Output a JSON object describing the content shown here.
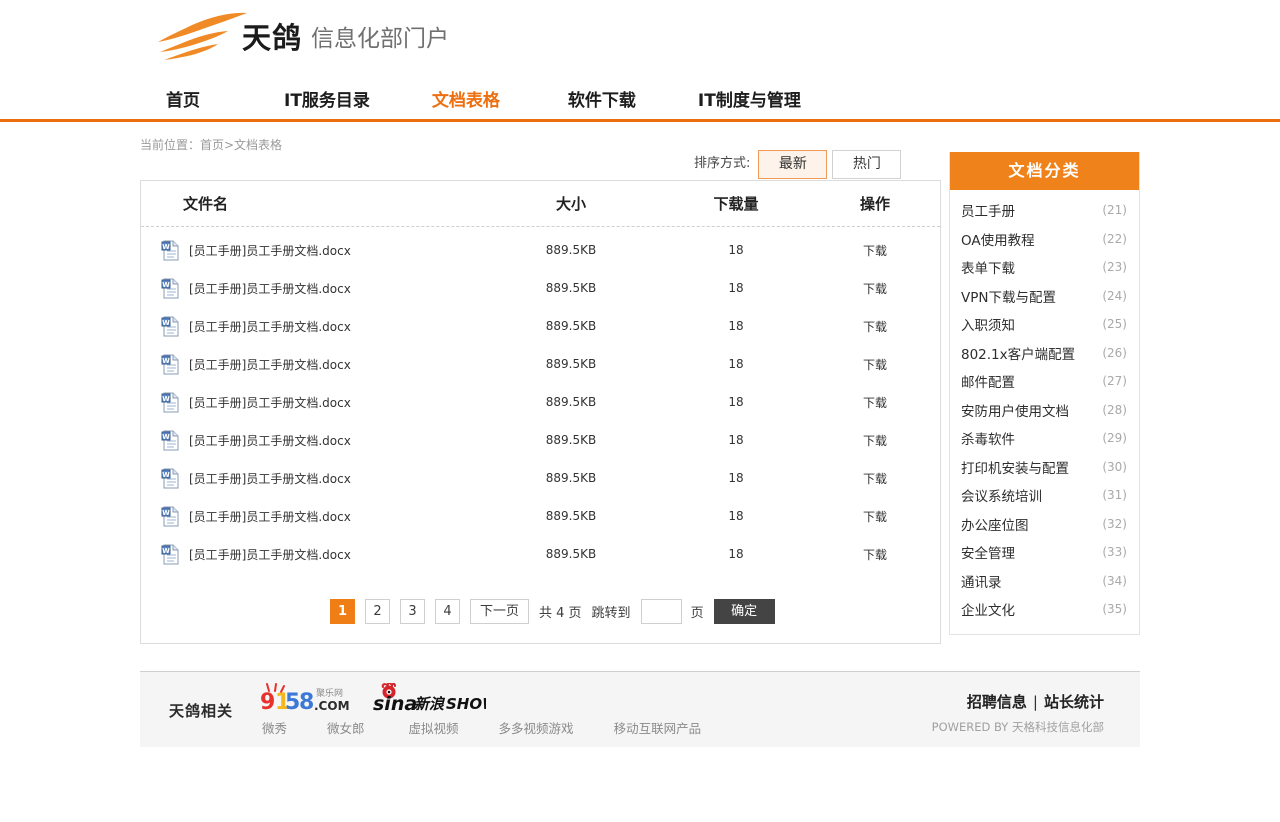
{
  "brand": {
    "logo_icon": "swoosh-bird-logo",
    "name": "天鸽",
    "subtitle": "信息化部门户",
    "accent_color": "#ee6f10",
    "sidebar_header_color": "#f0821b"
  },
  "nav": {
    "items": [
      {
        "label": "首页",
        "active": false
      },
      {
        "label": "IT服务目录",
        "active": false
      },
      {
        "label": "文档表格",
        "active": true
      },
      {
        "label": "软件下载",
        "active": false
      },
      {
        "label": "IT制度与管理",
        "active": false
      }
    ]
  },
  "breadcrumb": {
    "text": "当前位置：首页>文档表格"
  },
  "sort": {
    "label": "排序方式:",
    "tabs": [
      {
        "label": "最新",
        "active": true
      },
      {
        "label": "热门",
        "active": false
      }
    ]
  },
  "table": {
    "headers": {
      "name": "文件名",
      "size": "大小",
      "downloads": "下载量",
      "action": "操作"
    },
    "rows": [
      {
        "icon": "word-document-icon",
        "name": "[员工手册]员工手册文档.docx",
        "size": "889.5KB",
        "downloads": "18",
        "action": "下载"
      },
      {
        "icon": "word-document-icon",
        "name": "[员工手册]员工手册文档.docx",
        "size": "889.5KB",
        "downloads": "18",
        "action": "下载"
      },
      {
        "icon": "word-document-icon",
        "name": "[员工手册]员工手册文档.docx",
        "size": "889.5KB",
        "downloads": "18",
        "action": "下载"
      },
      {
        "icon": "word-document-icon",
        "name": "[员工手册]员工手册文档.docx",
        "size": "889.5KB",
        "downloads": "18",
        "action": "下载"
      },
      {
        "icon": "word-document-icon",
        "name": "[员工手册]员工手册文档.docx",
        "size": "889.5KB",
        "downloads": "18",
        "action": "下载"
      },
      {
        "icon": "word-document-icon",
        "name": "[员工手册]员工手册文档.docx",
        "size": "889.5KB",
        "downloads": "18",
        "action": "下载"
      },
      {
        "icon": "word-document-icon",
        "name": "[员工手册]员工手册文档.docx",
        "size": "889.5KB",
        "downloads": "18",
        "action": "下载"
      },
      {
        "icon": "word-document-icon",
        "name": "[员工手册]员工手册文档.docx",
        "size": "889.5KB",
        "downloads": "18",
        "action": "下载"
      },
      {
        "icon": "word-document-icon",
        "name": "[员工手册]员工手册文档.docx",
        "size": "889.5KB",
        "downloads": "18",
        "action": "下载"
      }
    ]
  },
  "pagination": {
    "pages": [
      {
        "label": "1",
        "active": true
      },
      {
        "label": "2",
        "active": false
      },
      {
        "label": "3",
        "active": false
      },
      {
        "label": "4",
        "active": false
      }
    ],
    "next_label": "下一页",
    "total_text": "共 4 页",
    "jump_label": "跳转到",
    "jump_value": "",
    "jump_placeholder": "",
    "page_unit": "页",
    "confirm_label": "确定"
  },
  "sidebar": {
    "title": "文档分类",
    "items": [
      {
        "label": "员工手册",
        "count": "(21)"
      },
      {
        "label": "OA使用教程",
        "count": "(22)"
      },
      {
        "label": "表单下载",
        "count": "(23)"
      },
      {
        "label": "VPN下载与配置",
        "count": "(24)"
      },
      {
        "label": "入职须知",
        "count": "(25)"
      },
      {
        "label": "802.1x客户端配置",
        "count": "(26)"
      },
      {
        "label": "邮件配置",
        "count": "(27)"
      },
      {
        "label": "安防用户使用文档",
        "count": "(28)"
      },
      {
        "label": "杀毒软件",
        "count": "(29)"
      },
      {
        "label": "打印机安装与配置",
        "count": "(30)"
      },
      {
        "label": "会议系统培训",
        "count": "(31)"
      },
      {
        "label": "办公座位图",
        "count": "(32)"
      },
      {
        "label": "安全管理",
        "count": "(33)"
      },
      {
        "label": "通讯录",
        "count": "(34)"
      },
      {
        "label": "企业文化",
        "count": "(35)"
      }
    ]
  },
  "footer": {
    "label": "天鸽相关",
    "logos": [
      {
        "icon": "9158-logo",
        "digits": "9158",
        "suffix": ".COM",
        "tag": "聚乐网"
      },
      {
        "icon": "sina-show-logo",
        "brand": "sina",
        "cn": "新浪SHOW"
      }
    ],
    "links": [
      "微秀",
      "微女郎",
      "虚拟视频",
      "多多视频游戏",
      "移动互联网产品"
    ],
    "right_links": {
      "jobs": "招聘信息",
      "separator": "|",
      "stats": "站长统计"
    },
    "powered_by": "POWERED BY 天格科技信息化部"
  }
}
